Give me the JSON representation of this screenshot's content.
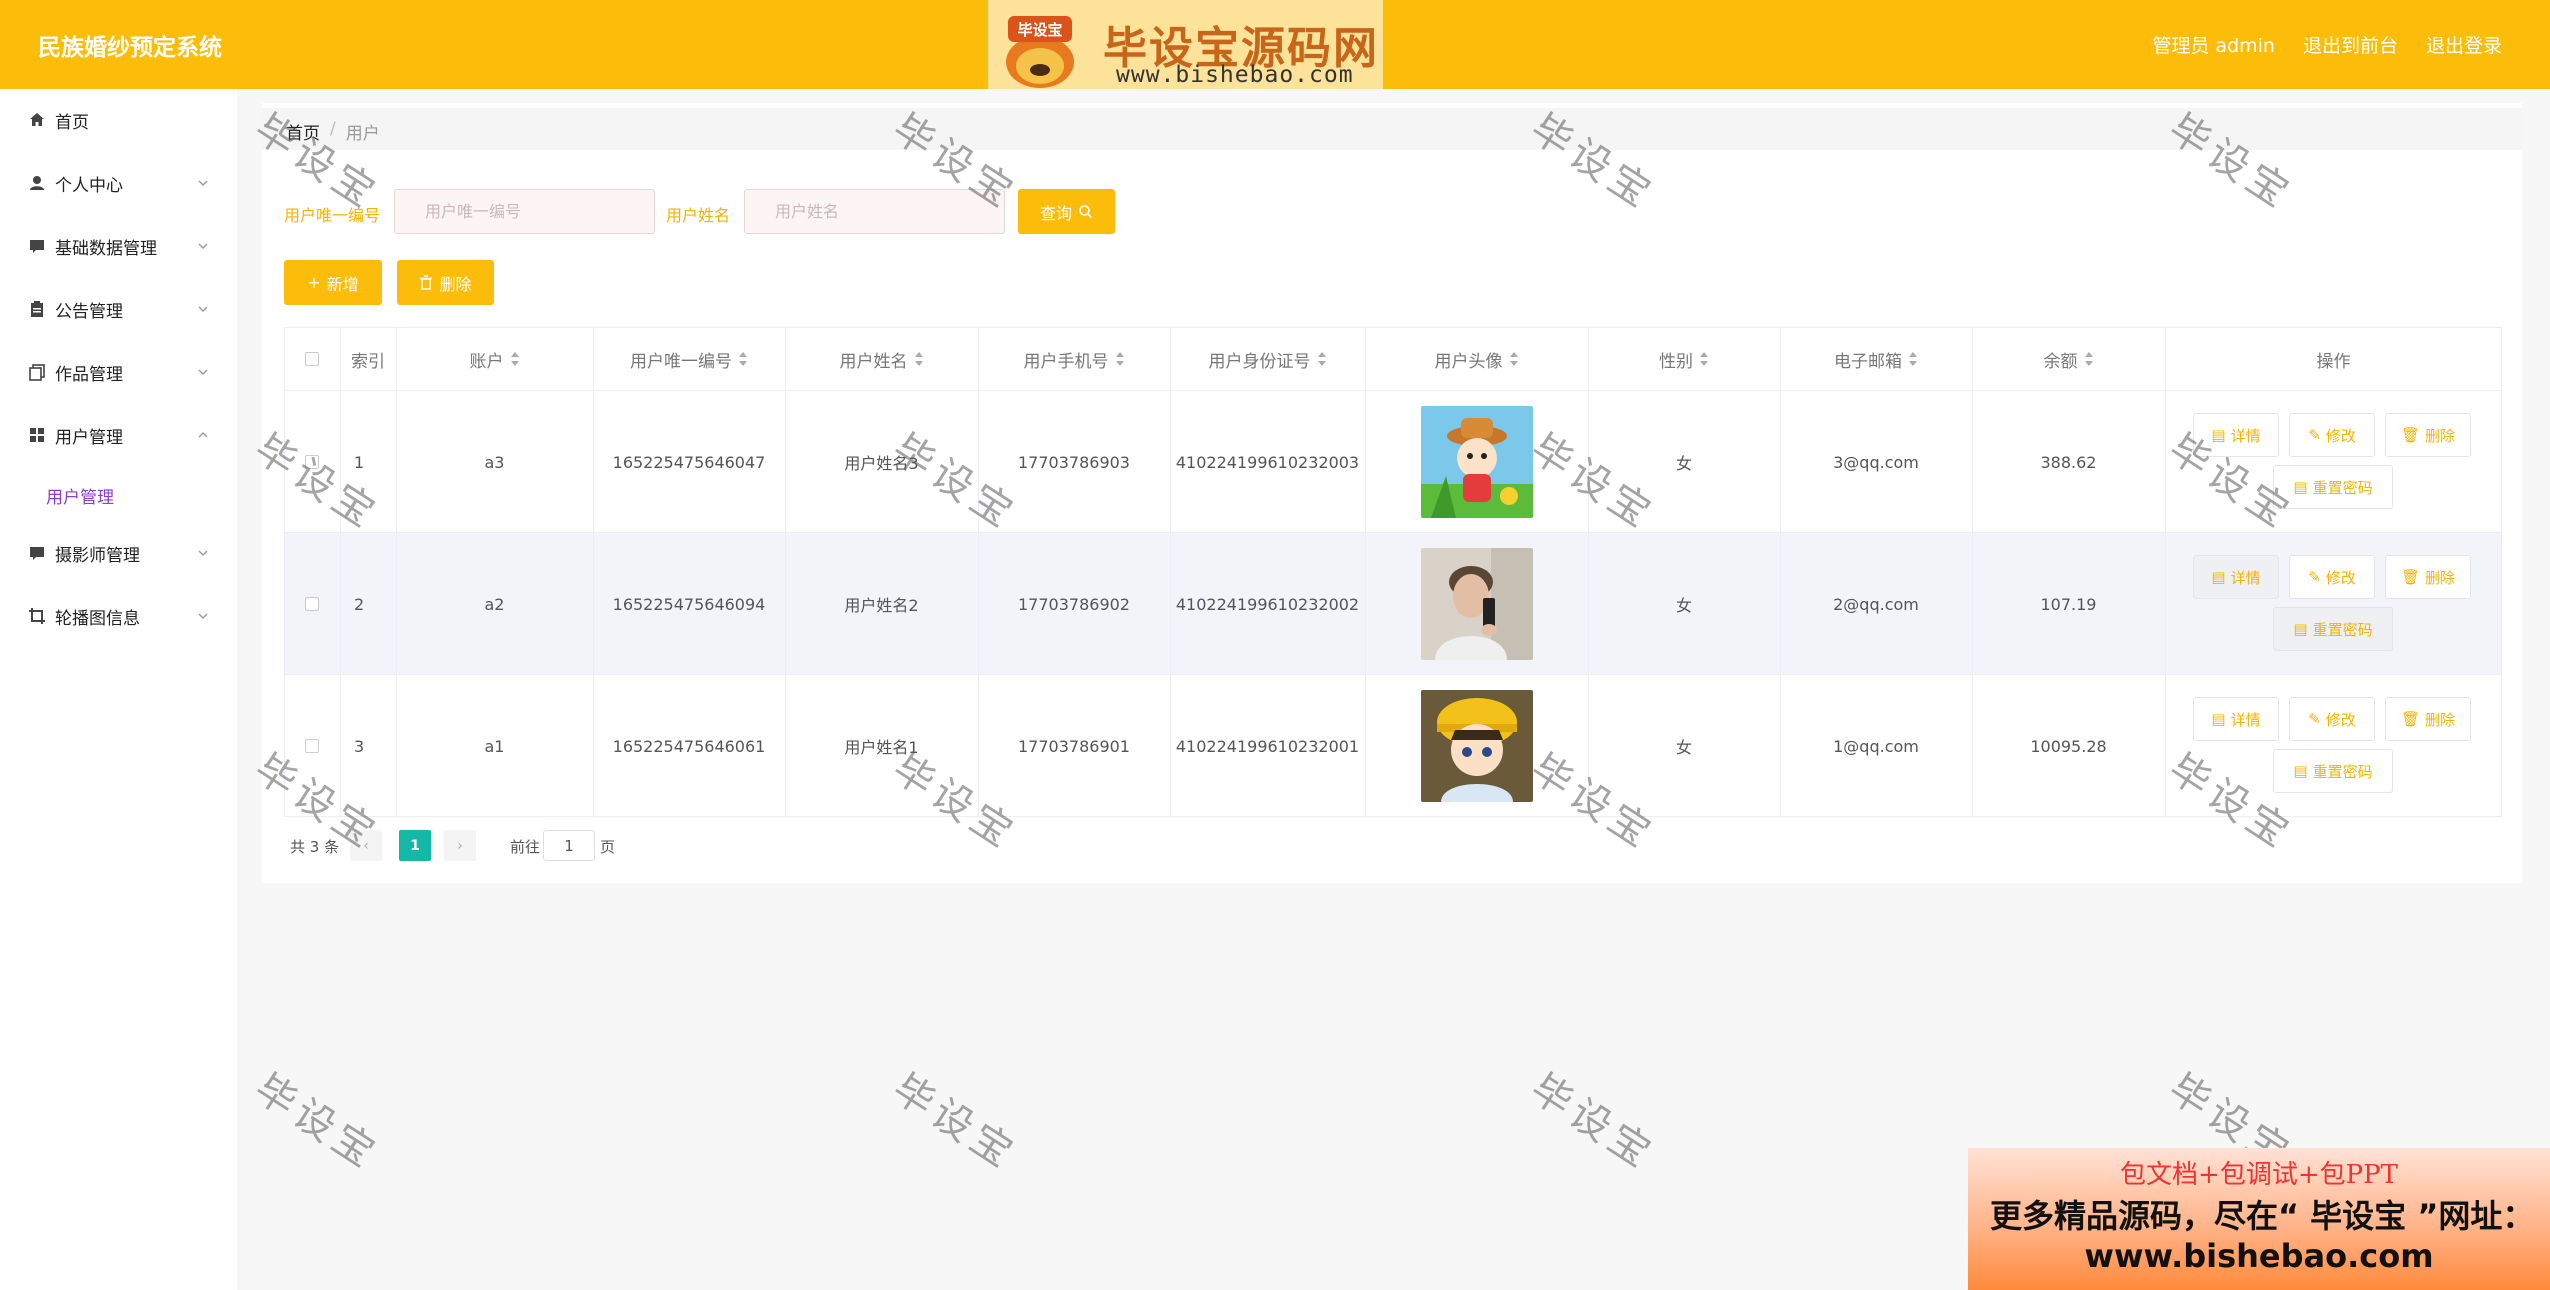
{
  "header": {
    "app_title": "民族婚纱预定系统",
    "admin_label": "管理员 admin",
    "to_front": "退出到前台",
    "logout": "退出登录"
  },
  "logo": {
    "mascot_text": "毕设宝",
    "brand": "毕设宝源码网",
    "url": "www.bishebao.com"
  },
  "sidebar": {
    "items": [
      {
        "label": "首页",
        "icon": "home-icon"
      },
      {
        "label": "个人中心",
        "icon": "user-icon"
      },
      {
        "label": "基础数据管理",
        "icon": "chat-icon"
      },
      {
        "label": "公告管理",
        "icon": "clipboard-icon"
      },
      {
        "label": "作品管理",
        "icon": "copy-icon"
      },
      {
        "label": "用户管理",
        "icon": "grid-icon"
      },
      {
        "label": "摄影师管理",
        "icon": "chat-icon"
      },
      {
        "label": "轮播图信息",
        "icon": "crop-icon"
      }
    ],
    "submenu_active": "用户管理"
  },
  "breadcrumb": {
    "home": "首页",
    "sep": "/",
    "current": "用户"
  },
  "search": {
    "id_label": "用户唯一编号",
    "id_placeholder": "用户唯一编号",
    "name_label": "用户姓名",
    "name_placeholder": "用户姓名",
    "query_button": "查询"
  },
  "actions": {
    "add": "新增",
    "delete": "删除"
  },
  "table": {
    "headers": [
      "索引",
      "账户",
      "用户唯一编号",
      "用户姓名",
      "用户手机号",
      "用户身份证号",
      "用户头像",
      "性别",
      "电子邮箱",
      "余额",
      "操作"
    ],
    "rows": [
      {
        "index": "1",
        "account": "a3",
        "uid": "165225475646047",
        "name": "用户姓名3",
        "phone": "17703786903",
        "idcard": "410224199610232003",
        "gender": "女",
        "email": "3@qq.com",
        "balance": "388.62",
        "avatar": "cartoon-girl-avatar"
      },
      {
        "index": "2",
        "account": "a2",
        "uid": "165225475646094",
        "name": "用户姓名2",
        "phone": "17703786902",
        "idcard": "410224199610232002",
        "gender": "女",
        "email": "2@qq.com",
        "balance": "107.19",
        "avatar": "selfie-man-avatar"
      },
      {
        "index": "3",
        "account": "a1",
        "uid": "165225475646061",
        "name": "用户姓名1",
        "phone": "17703786901",
        "idcard": "410224199610232001",
        "gender": "女",
        "email": "1@qq.com",
        "balance": "10095.28",
        "avatar": "anime-boy-avatar"
      }
    ],
    "op_labels": {
      "detail": "详情",
      "edit": "修改",
      "delete": "删除",
      "reset": "重置密码"
    }
  },
  "pagination": {
    "total": "共 3 条",
    "current": "1",
    "goto": "前往",
    "page_input": "1",
    "page_suffix": "页"
  },
  "watermark": "毕设宝",
  "ad": {
    "line1": "包文档+包调试+包PPT",
    "line2": "更多精品源码，尽在“ 毕设宝 ”网址：",
    "line3": "www.bishebao.com"
  },
  "colors": {
    "accent": "#fcbd0a",
    "active_page": "#14b8a6",
    "submenu_active": "#8a3fd1"
  }
}
